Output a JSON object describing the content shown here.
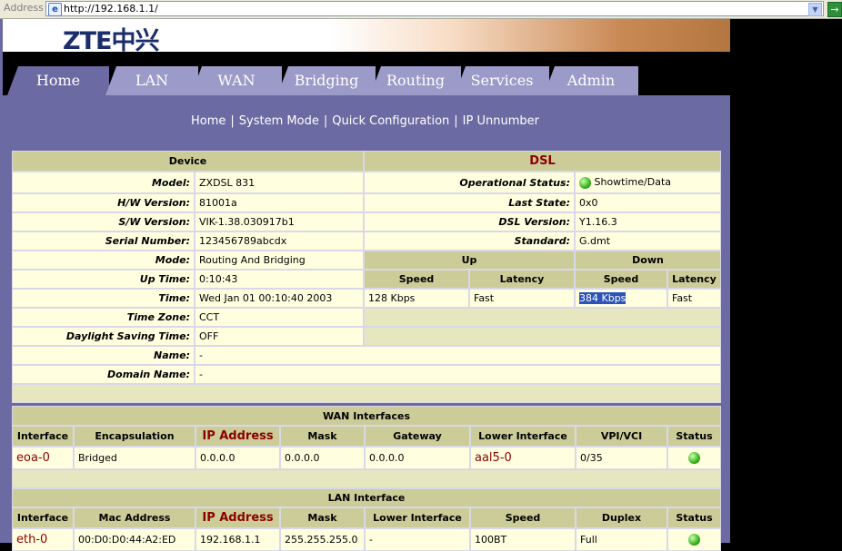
{
  "browser": {
    "address_label": "Address",
    "url": "http://192.168.1.1/"
  },
  "brand": {
    "logo": "ZTE中兴"
  },
  "nav": {
    "tabs": [
      "Home",
      "LAN",
      "WAN",
      "Bridging",
      "Routing",
      "Services",
      "Admin"
    ],
    "active": "Home"
  },
  "subnav": [
    "Home",
    "System Mode",
    "Quick Configuration",
    "IP Unnumber"
  ],
  "device": {
    "header": "Device",
    "rows": [
      {
        "label": "Model:",
        "value": "ZXDSL 831"
      },
      {
        "label": "H/W Version:",
        "value": "81001a"
      },
      {
        "label": "S/W Version:",
        "value": "VIK-1.38.030917b1"
      },
      {
        "label": "Serial Number:",
        "value": "123456789abcdx"
      },
      {
        "label": "Mode:",
        "value": "Routing And Bridging"
      },
      {
        "label": "Up Time:",
        "value": "0:10:43"
      },
      {
        "label": "Time:",
        "value": "Wed Jan 01 00:10:40 2003"
      },
      {
        "label": "Time Zone:",
        "value": "CCT"
      },
      {
        "label": "Daylight Saving Time:",
        "value": "OFF"
      },
      {
        "label": "Name:",
        "value": "-"
      },
      {
        "label": "Domain Name:",
        "value": "-"
      }
    ]
  },
  "dsl": {
    "header": "DSL",
    "op_status_label": "Operational Status:",
    "op_status_value": "Showtime/Data",
    "last_state_label": "Last State:",
    "last_state_value": "0x0",
    "version_label": "DSL Version:",
    "version_value": "Y1.16.3",
    "standard_label": "Standard:",
    "standard_value": "G.dmt",
    "up": "Up",
    "down": "Down",
    "speed": "Speed",
    "latency": "Latency",
    "up_speed": "128 Kbps",
    "up_latency": "Fast",
    "down_speed": "384 Kbps",
    "down_latency": "Fast"
  },
  "wan": {
    "title": "WAN Interfaces",
    "columns": [
      "Interface",
      "Encapsulation",
      "IP Address",
      "Mask",
      "Gateway",
      "Lower Interface",
      "VPI/VCI",
      "Status"
    ],
    "row": {
      "interface": "eoa-0",
      "encapsulation": "Bridged",
      "ip": "0.0.0.0",
      "mask": "0.0.0.0",
      "gateway": "0.0.0.0",
      "lower": "aal5-0",
      "vpivci": "0/35"
    }
  },
  "lan": {
    "title": "LAN Interface",
    "columns": [
      "Interface",
      "Mac Address",
      "IP Address",
      "Mask",
      "Lower Interface",
      "Speed",
      "Duplex",
      "Status"
    ],
    "row": {
      "interface": "eth-0",
      "mac": "00:D0:D0:44:A2:ED",
      "ip": "192.168.1.1",
      "mask": "255.255.255.0",
      "lower": "-",
      "speed": "100BT",
      "duplex": "Full"
    }
  },
  "colors": {
    "tab": "#9b9ac8",
    "panel": "#6c6aa2",
    "header_cell": "#cccc99",
    "cell": "#ffffe0",
    "link_red": "#8b0000",
    "status_green": "#3ab11b"
  }
}
